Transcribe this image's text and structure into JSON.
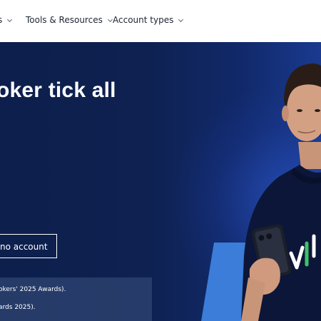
{
  "nav": {
    "items": [
      {
        "label": "s"
      },
      {
        "label": "Tools & Resources"
      },
      {
        "label": "Account types"
      }
    ]
  },
  "hero": {
    "title": "oker tick all",
    "demo_button_label": "no account",
    "awards": [
      "okers' 2025 Awards).",
      "ards 2025)."
    ]
  },
  "colors": {
    "nav_background": "#ffffff",
    "hero_background": "#0d1f4c",
    "accent_blue": "#3b7dd8",
    "accent_green": "#3cc46a"
  },
  "icons": {
    "nav_chevron": "chevron-down-icon"
  }
}
